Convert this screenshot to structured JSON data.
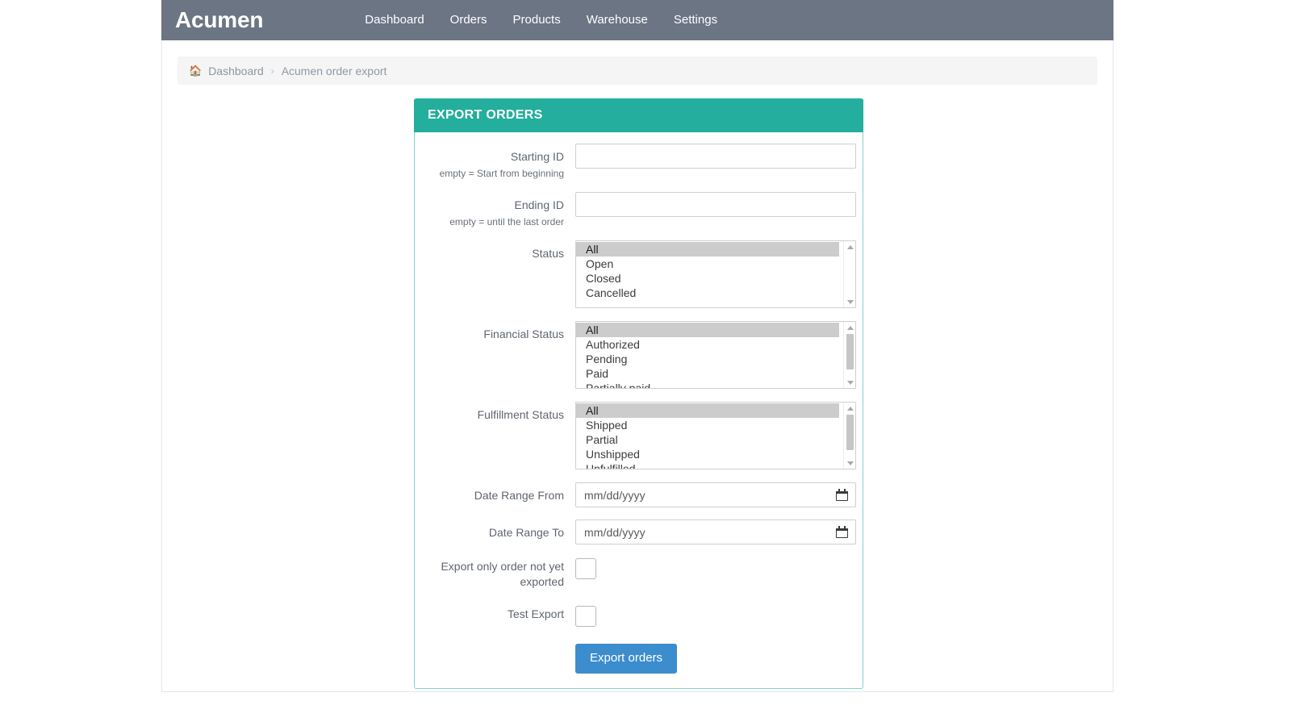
{
  "navbar": {
    "brand": "Acumen",
    "links": [
      {
        "label": "Dashboard"
      },
      {
        "label": "Orders"
      },
      {
        "label": "Products"
      },
      {
        "label": "Warehouse"
      },
      {
        "label": "Settings"
      }
    ]
  },
  "breadcrumb": {
    "home_icon": "home-icon",
    "root": "Dashboard",
    "separator": "›",
    "current": "Acumen order export"
  },
  "panel": {
    "title": "EXPORT ORDERS",
    "accent_color": "#23ae9d",
    "border_color": "#7fd6cb",
    "fields": {
      "starting_id": {
        "label": "Starting ID",
        "hint": "empty = Start from beginning",
        "value": "",
        "placeholder": ""
      },
      "ending_id": {
        "label": "Ending ID",
        "hint": "empty = until the last order",
        "value": "",
        "placeholder": ""
      },
      "status": {
        "label": "Status",
        "options": [
          "All",
          "Open",
          "Closed",
          "Cancelled"
        ],
        "selected": "All"
      },
      "financial_status": {
        "label": "Financial Status",
        "options": [
          "All",
          "Authorized",
          "Pending",
          "Paid",
          "Partially paid"
        ],
        "selected": "All"
      },
      "fulfillment_status": {
        "label": "Fulfillment Status",
        "options": [
          "All",
          "Shipped",
          "Partial",
          "Unshipped",
          "Unfulfilled"
        ],
        "selected": "All"
      },
      "date_from": {
        "label": "Date Range From",
        "placeholder": "mm/dd/yyyy",
        "value": "",
        "icon": "calendar-icon"
      },
      "date_to": {
        "label": "Date Range To",
        "placeholder": "mm/dd/yyyy",
        "value": "",
        "icon": "calendar-icon"
      },
      "not_exported": {
        "label": "Export only order not yet exported",
        "checked": false
      },
      "test_export": {
        "label": "Test Export",
        "checked": false
      }
    },
    "submit": {
      "label": "Export orders",
      "color": "#3c8dcd"
    }
  }
}
